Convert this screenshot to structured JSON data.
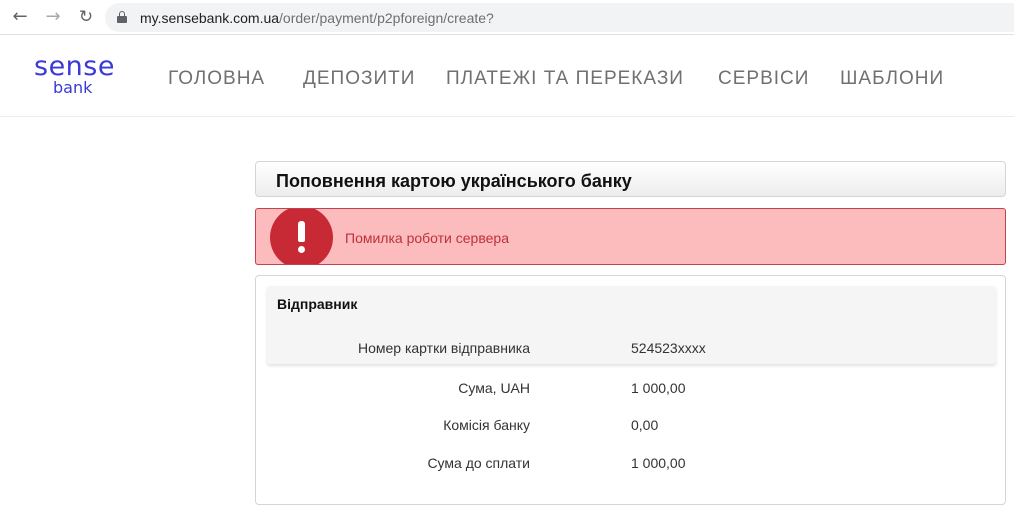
{
  "browser": {
    "url_host": "my.sensebank.com.ua",
    "url_path": "/order/payment/p2pforeign/create?"
  },
  "logo": {
    "line1": "sense",
    "line2": "bank",
    "brand_color": "#3a3ad6"
  },
  "nav": {
    "items": [
      {
        "label": "ГОЛОВНА"
      },
      {
        "label": "ДЕПОЗИТИ"
      },
      {
        "label": "ПЛАТЕЖІ ТА ПЕРЕКАЗИ"
      },
      {
        "label": "СЕРВІСИ"
      },
      {
        "label": "ШАБЛОНИ"
      }
    ]
  },
  "page": {
    "title": "Поповнення картою українського банку"
  },
  "alert": {
    "message": "Помилка роботи сервера",
    "icon": "exclamation-icon",
    "color": "#c72a35"
  },
  "sender": {
    "heading": "Відправник",
    "card_label": "Номер картки відправника",
    "card_value": "524523xxxx"
  },
  "summary": {
    "rows": [
      {
        "label": "Сума, UAH",
        "value": "1 000,00"
      },
      {
        "label": "Комісія банку",
        "value": "0,00"
      },
      {
        "label": "Сума до сплати",
        "value": "1 000,00"
      }
    ]
  }
}
